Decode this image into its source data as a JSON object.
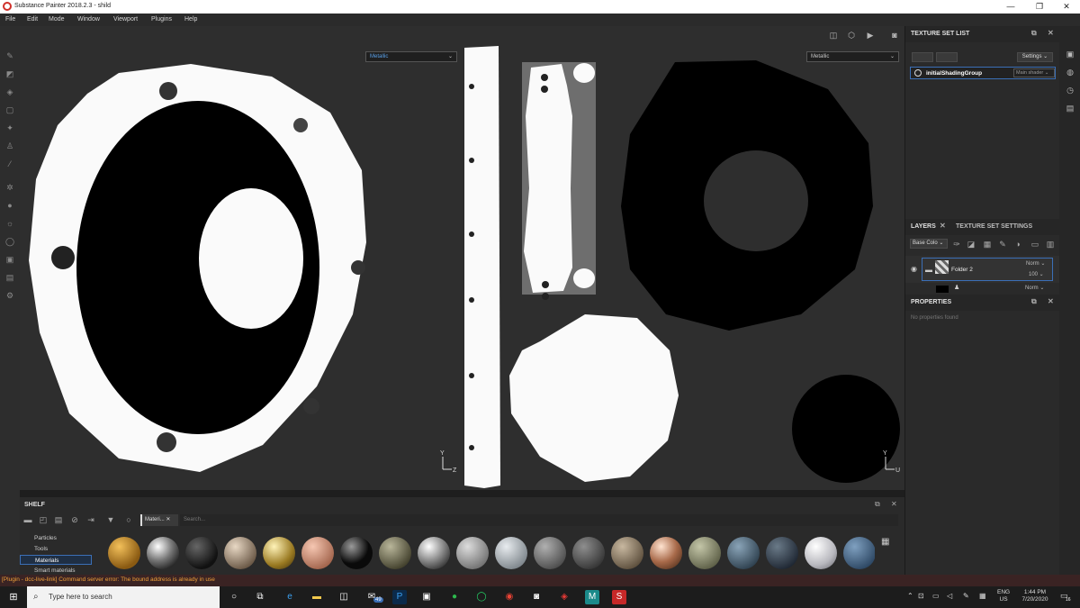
{
  "window": {
    "title": "Substance Painter 2018.2.3 - shild",
    "minimize": "—",
    "maximize": "❐",
    "close": "✕"
  },
  "menu": [
    "File",
    "Edit",
    "Mode",
    "Window",
    "Viewport",
    "Plugins",
    "Help"
  ],
  "viewport": {
    "left_channel": "Metallic",
    "right_channel": "Metallic",
    "axis_y": "Y",
    "axis_z": "Z",
    "axis_u": "U"
  },
  "texture_set_list": {
    "title": "TEXTURE SET LIST",
    "settings_label": "Settings",
    "item_name": "initialShadingGroup",
    "item_shader": "Main shader"
  },
  "layers": {
    "tab_layers": "LAYERS",
    "tab_settings": "TEXTURE SET SETTINGS",
    "channel_select": "Base Colo",
    "folder_name": "Folder 2",
    "blend_mode": "Norm",
    "opacity": "100",
    "second_blend": "Norm"
  },
  "properties": {
    "title": "PROPERTIES",
    "empty_text": "No properties found"
  },
  "shelf": {
    "title": "SHELF",
    "filter_chip": "Materi...",
    "search_placeholder": "Search...",
    "categories": [
      "Particles",
      "Tools",
      "Materials",
      "Smart materials"
    ],
    "active_category": "Materials"
  },
  "status": {
    "message": "[Plugin - dcc-live-link] Command server error: The bound address is already in use"
  },
  "taskbar": {
    "search_placeholder": "Type here to search",
    "mail_badge": "49",
    "lang": "ENG",
    "region": "US",
    "time": "1:44 PM",
    "date": "7/20/2020",
    "notif_count": "16"
  },
  "colors": {
    "accent": "#3b6fb6",
    "status_warning": "#f0a13a",
    "app_red": "#d0302a"
  }
}
